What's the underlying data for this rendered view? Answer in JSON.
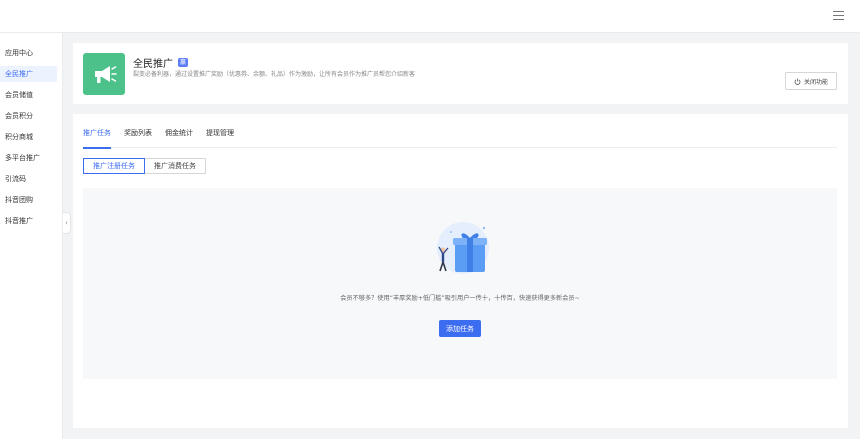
{
  "header": {
    "menu_icon": "hamburger-menu-icon"
  },
  "sidebar": {
    "items": [
      {
        "label": "应用中心",
        "active": false
      },
      {
        "label": "全民推广",
        "active": true
      },
      {
        "label": "会员储值",
        "active": false
      },
      {
        "label": "会员积分",
        "active": false
      },
      {
        "label": "积分商城",
        "active": false
      },
      {
        "label": "多平台推广",
        "active": false
      },
      {
        "label": "引流码",
        "active": false
      },
      {
        "label": "抖音团购",
        "active": false
      },
      {
        "label": "抖音推广",
        "active": false
      }
    ],
    "collapse_glyph": "‹"
  },
  "app": {
    "title": "全民推广",
    "badge": "赢",
    "description": "裂变必备利器，通过设置推广奖励（优惠券、余额、礼品）作为激励，让所有会员作为推广员帮您介绍新客",
    "close_button_label": "关闭功能",
    "icon_color": "#4cc28a"
  },
  "tabs": [
    {
      "label": "推广任务",
      "active": true
    },
    {
      "label": "奖励列表",
      "active": false
    },
    {
      "label": "佣金统计",
      "active": false
    },
    {
      "label": "提现管理",
      "active": false
    }
  ],
  "segments": [
    {
      "label": "推广注册任务",
      "active": true
    },
    {
      "label": "推广消费任务",
      "active": false
    }
  ],
  "empty_state": {
    "message": "会员不够多？使用“丰厚奖励+低门槛”吸引用户一传十，十传百，快速获得更多新会员~",
    "add_button_label": "添加任务"
  },
  "colors": {
    "accent": "#3c6cf0",
    "background": "#f2f3f5"
  }
}
